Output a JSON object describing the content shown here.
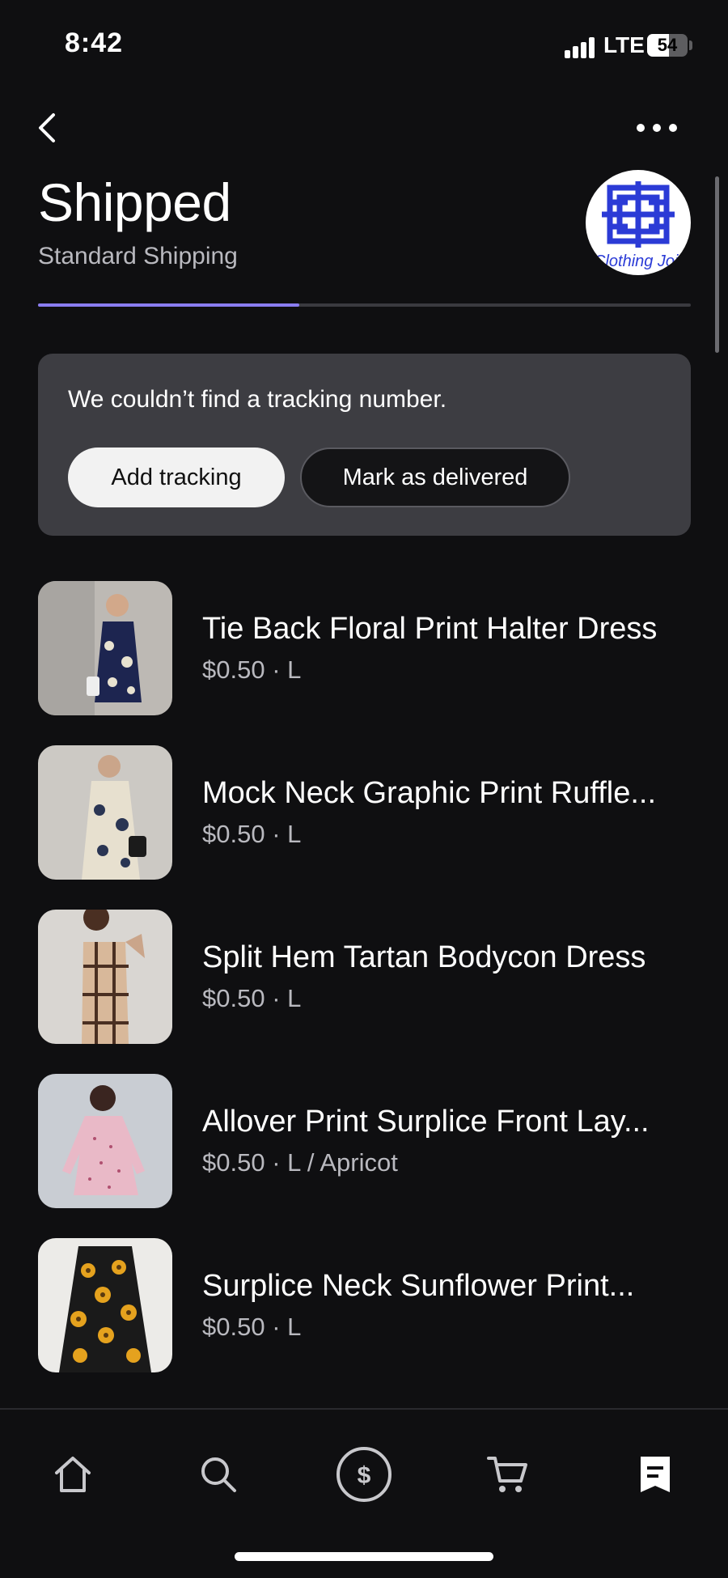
{
  "status_bar": {
    "time": "8:42",
    "network": "LTE",
    "battery": "54",
    "battery_fraction": 0.54
  },
  "header": {
    "title": "Shipped",
    "subtitle": "Standard Shipping",
    "store_logo_text": "Clothing Joint",
    "progress_fraction": 0.4
  },
  "tracking": {
    "message": "We couldn’t find a tracking number.",
    "add_label": "Add tracking",
    "mark_label": "Mark as delivered"
  },
  "items": [
    {
      "name": "Tie Back Floral Print Halter Dress",
      "meta": "$0.50 · L"
    },
    {
      "name": "Mock Neck Graphic Print Ruffle...",
      "meta": "$0.50 · L"
    },
    {
      "name": "Split Hem Tartan Bodycon Dress",
      "meta": "$0.50 · L"
    },
    {
      "name": "Allover Print Surplice Front Lay...",
      "meta": "$0.50 · L / Apricot"
    },
    {
      "name": "Surplice Neck Sunflower Print...",
      "meta": "$0.50 · L"
    }
  ],
  "tabs": [
    "home-icon",
    "search-icon",
    "dollar-icon",
    "cart-icon",
    "receipt-icon"
  ],
  "colors": {
    "background": "#0f0f11",
    "card": "#3d3d42",
    "accent": "#8a7df0",
    "logo_blue": "#2b3bd6"
  }
}
